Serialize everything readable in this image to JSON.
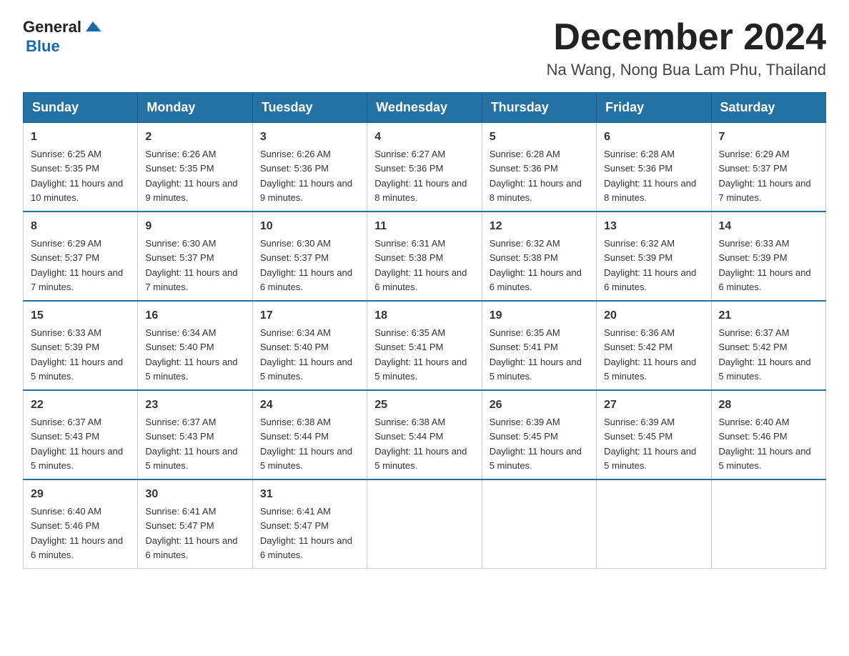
{
  "logo": {
    "general": "General",
    "blue": "Blue"
  },
  "header": {
    "month_year": "December 2024",
    "location": "Na Wang, Nong Bua Lam Phu, Thailand"
  },
  "days_of_week": [
    "Sunday",
    "Monday",
    "Tuesday",
    "Wednesday",
    "Thursday",
    "Friday",
    "Saturday"
  ],
  "weeks": [
    [
      {
        "day": "1",
        "sunrise": "6:25 AM",
        "sunset": "5:35 PM",
        "daylight": "11 hours and 10 minutes."
      },
      {
        "day": "2",
        "sunrise": "6:26 AM",
        "sunset": "5:35 PM",
        "daylight": "11 hours and 9 minutes."
      },
      {
        "day": "3",
        "sunrise": "6:26 AM",
        "sunset": "5:36 PM",
        "daylight": "11 hours and 9 minutes."
      },
      {
        "day": "4",
        "sunrise": "6:27 AM",
        "sunset": "5:36 PM",
        "daylight": "11 hours and 8 minutes."
      },
      {
        "day": "5",
        "sunrise": "6:28 AM",
        "sunset": "5:36 PM",
        "daylight": "11 hours and 8 minutes."
      },
      {
        "day": "6",
        "sunrise": "6:28 AM",
        "sunset": "5:36 PM",
        "daylight": "11 hours and 8 minutes."
      },
      {
        "day": "7",
        "sunrise": "6:29 AM",
        "sunset": "5:37 PM",
        "daylight": "11 hours and 7 minutes."
      }
    ],
    [
      {
        "day": "8",
        "sunrise": "6:29 AM",
        "sunset": "5:37 PM",
        "daylight": "11 hours and 7 minutes."
      },
      {
        "day": "9",
        "sunrise": "6:30 AM",
        "sunset": "5:37 PM",
        "daylight": "11 hours and 7 minutes."
      },
      {
        "day": "10",
        "sunrise": "6:30 AM",
        "sunset": "5:37 PM",
        "daylight": "11 hours and 6 minutes."
      },
      {
        "day": "11",
        "sunrise": "6:31 AM",
        "sunset": "5:38 PM",
        "daylight": "11 hours and 6 minutes."
      },
      {
        "day": "12",
        "sunrise": "6:32 AM",
        "sunset": "5:38 PM",
        "daylight": "11 hours and 6 minutes."
      },
      {
        "day": "13",
        "sunrise": "6:32 AM",
        "sunset": "5:39 PM",
        "daylight": "11 hours and 6 minutes."
      },
      {
        "day": "14",
        "sunrise": "6:33 AM",
        "sunset": "5:39 PM",
        "daylight": "11 hours and 6 minutes."
      }
    ],
    [
      {
        "day": "15",
        "sunrise": "6:33 AM",
        "sunset": "5:39 PM",
        "daylight": "11 hours and 5 minutes."
      },
      {
        "day": "16",
        "sunrise": "6:34 AM",
        "sunset": "5:40 PM",
        "daylight": "11 hours and 5 minutes."
      },
      {
        "day": "17",
        "sunrise": "6:34 AM",
        "sunset": "5:40 PM",
        "daylight": "11 hours and 5 minutes."
      },
      {
        "day": "18",
        "sunrise": "6:35 AM",
        "sunset": "5:41 PM",
        "daylight": "11 hours and 5 minutes."
      },
      {
        "day": "19",
        "sunrise": "6:35 AM",
        "sunset": "5:41 PM",
        "daylight": "11 hours and 5 minutes."
      },
      {
        "day": "20",
        "sunrise": "6:36 AM",
        "sunset": "5:42 PM",
        "daylight": "11 hours and 5 minutes."
      },
      {
        "day": "21",
        "sunrise": "6:37 AM",
        "sunset": "5:42 PM",
        "daylight": "11 hours and 5 minutes."
      }
    ],
    [
      {
        "day": "22",
        "sunrise": "6:37 AM",
        "sunset": "5:43 PM",
        "daylight": "11 hours and 5 minutes."
      },
      {
        "day": "23",
        "sunrise": "6:37 AM",
        "sunset": "5:43 PM",
        "daylight": "11 hours and 5 minutes."
      },
      {
        "day": "24",
        "sunrise": "6:38 AM",
        "sunset": "5:44 PM",
        "daylight": "11 hours and 5 minutes."
      },
      {
        "day": "25",
        "sunrise": "6:38 AM",
        "sunset": "5:44 PM",
        "daylight": "11 hours and 5 minutes."
      },
      {
        "day": "26",
        "sunrise": "6:39 AM",
        "sunset": "5:45 PM",
        "daylight": "11 hours and 5 minutes."
      },
      {
        "day": "27",
        "sunrise": "6:39 AM",
        "sunset": "5:45 PM",
        "daylight": "11 hours and 5 minutes."
      },
      {
        "day": "28",
        "sunrise": "6:40 AM",
        "sunset": "5:46 PM",
        "daylight": "11 hours and 5 minutes."
      }
    ],
    [
      {
        "day": "29",
        "sunrise": "6:40 AM",
        "sunset": "5:46 PM",
        "daylight": "11 hours and 6 minutes."
      },
      {
        "day": "30",
        "sunrise": "6:41 AM",
        "sunset": "5:47 PM",
        "daylight": "11 hours and 6 minutes."
      },
      {
        "day": "31",
        "sunrise": "6:41 AM",
        "sunset": "5:47 PM",
        "daylight": "11 hours and 6 minutes."
      },
      null,
      null,
      null,
      null
    ]
  ]
}
